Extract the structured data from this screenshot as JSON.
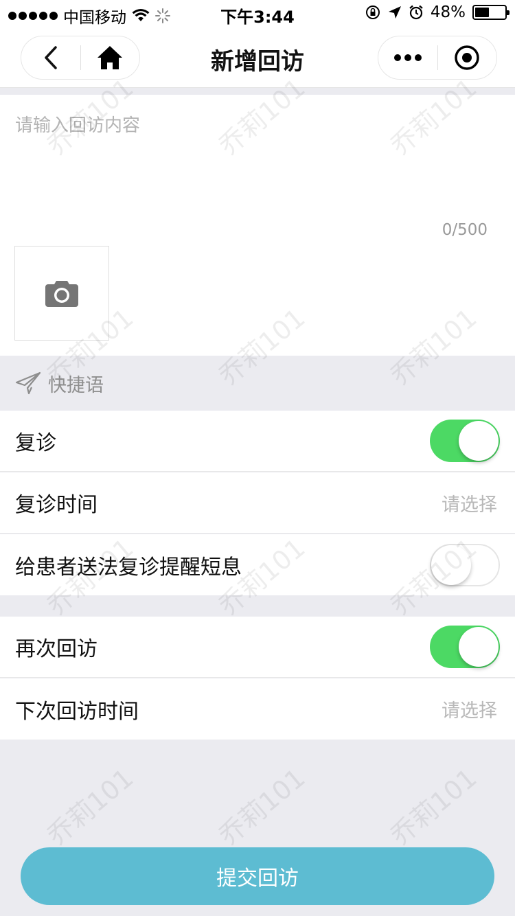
{
  "status_bar": {
    "carrier": "中国移动",
    "time": "下午3:44",
    "battery_percent": "48%",
    "battery_level": 0.48
  },
  "nav": {
    "title": "新增回访"
  },
  "editor": {
    "placeholder": "请输入回访内容",
    "char_count": "0/500"
  },
  "quick_phrase": {
    "label": "快捷语"
  },
  "rows": {
    "revisit": {
      "label": "复诊",
      "toggle_on": true
    },
    "revisit_time": {
      "label": "复诊时间",
      "value": "请选择"
    },
    "sms_reminder": {
      "label": "给患者送法复诊提醒短息",
      "toggle_on": false
    },
    "follow_up_again": {
      "label": "再次回访",
      "toggle_on": true
    },
    "next_follow_up_time": {
      "label": "下次回访时间",
      "value": "请选择"
    }
  },
  "submit": {
    "label": "提交回访"
  },
  "watermark": {
    "text": "乔莉101"
  },
  "colors": {
    "toggle_on": "#4cd964",
    "submit_bg": "#5dbcd2",
    "page_bg": "#ebebf0"
  },
  "icons": [
    "signal-dots-icon",
    "wifi-icon",
    "loading-icon",
    "rotation-lock-icon",
    "location-arrow-icon",
    "alarm-icon",
    "battery-icon",
    "back-chevron-icon",
    "home-icon",
    "more-dots-icon",
    "target-icon",
    "camera-icon",
    "paper-plane-icon"
  ]
}
